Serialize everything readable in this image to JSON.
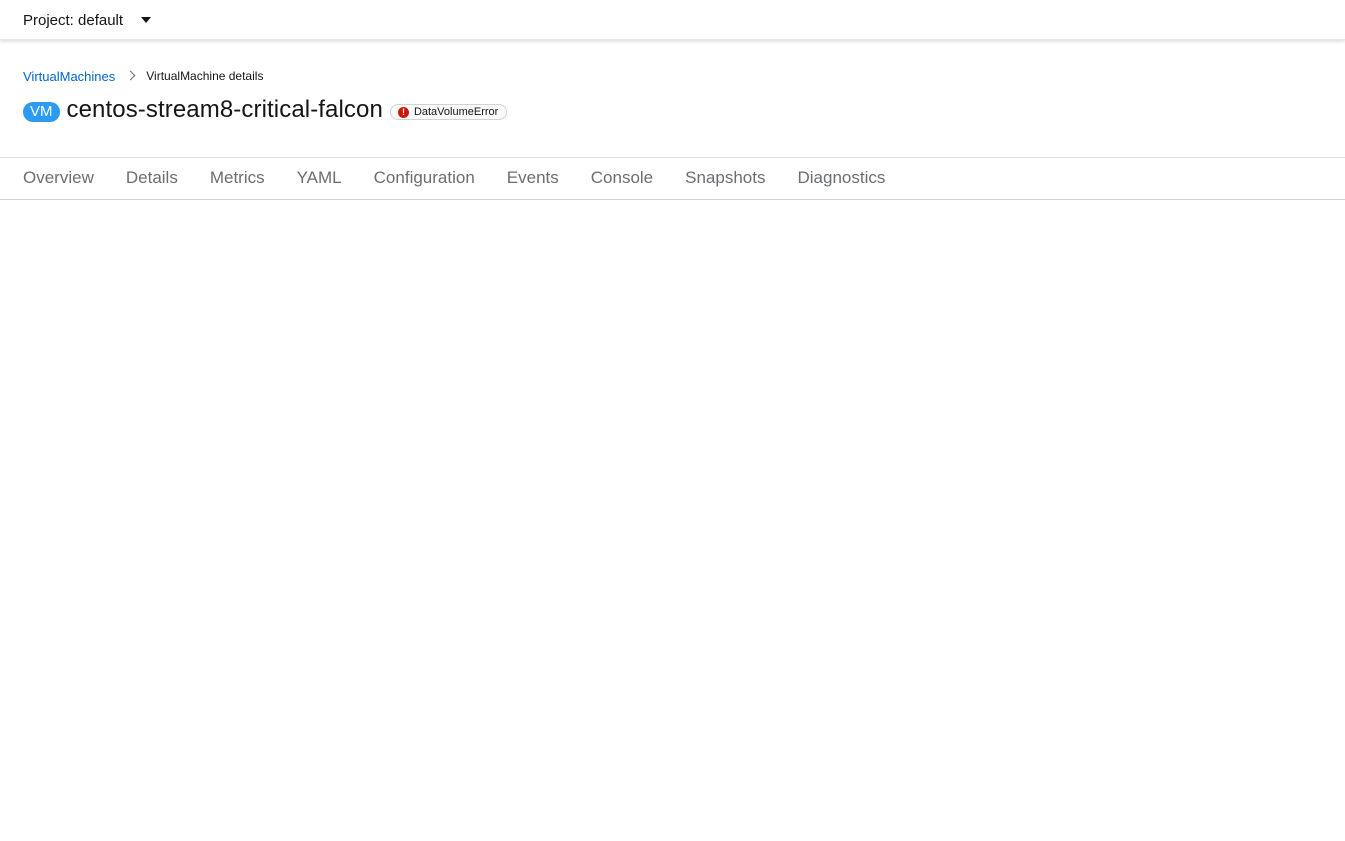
{
  "project_bar": {
    "label": "Project: default",
    "caret_icon": "caret-down-icon"
  },
  "breadcrumb": {
    "parent": "VirtualMachines",
    "current": "VirtualMachine details"
  },
  "header": {
    "badge": "VM",
    "name": "centos-stream8-critical-falcon",
    "status": "DataVolumeError",
    "status_icon": "!",
    "status_color": "#c9190b",
    "badge_color": "#2b9af3"
  },
  "tabs": [
    {
      "label": "Overview"
    },
    {
      "label": "Details"
    },
    {
      "label": "Metrics"
    },
    {
      "label": "YAML"
    },
    {
      "label": "Configuration"
    },
    {
      "label": "Events"
    },
    {
      "label": "Console"
    },
    {
      "label": "Snapshots"
    },
    {
      "label": "Diagnostics"
    }
  ]
}
